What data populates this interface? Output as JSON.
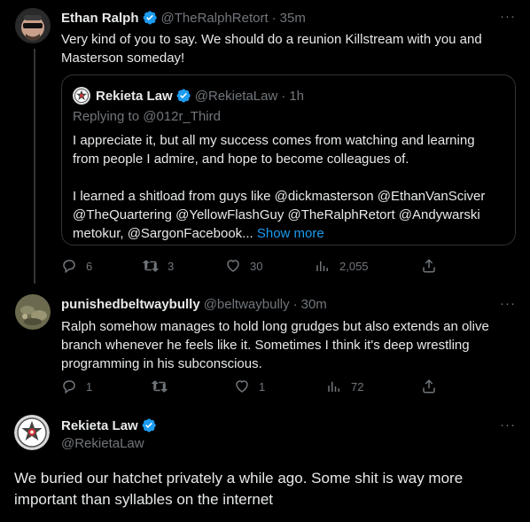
{
  "tweet1": {
    "name": "Ethan Ralph",
    "handle": "@TheRalphRetort",
    "time": "35m",
    "text": "Very kind of you to say. We should do a reunion Killstream with you and Masterson someday!",
    "quote": {
      "name": "Rekieta Law",
      "handle": "@RekietaLaw",
      "time": "1h",
      "replying_to": "Replying to @012r_Third",
      "para1": "I appreciate it, but all my success comes from watching and learning from people I admire, and hope to become colleagues of.",
      "para2": "I learned a shitload from guys like @dickmasterson @EthanVanSciver @TheQuartering @YellowFlashGuy @TheRalphRetort @Andywarski metokur, @SargonFacebook...",
      "show_more": "Show more"
    },
    "actions": {
      "replies": "6",
      "retweets": "3",
      "likes": "30",
      "views": "2,055"
    }
  },
  "tweet2": {
    "name": "punishedbeltwaybully",
    "handle": "@beltwaybully",
    "time": "30m",
    "text": "Ralph somehow manages to hold long grudges but also extends an olive branch whenever he feels like it. Sometimes I think it's deep wrestling programming in his subconscious.",
    "actions": {
      "replies": "1",
      "retweets": "",
      "likes": "1",
      "views": "72"
    }
  },
  "tweet3": {
    "name": "Rekieta Law",
    "handle": "@RekietaLaw",
    "text": "We buried our hatchet privately a while ago.  Some shit is way more important than syllables on the internet"
  },
  "more_label": "···",
  "colors": {
    "background": "#000000",
    "text": "#e7e9ea",
    "muted": "#71767b",
    "accent": "#1d9bf0",
    "border": "#2f3336"
  }
}
